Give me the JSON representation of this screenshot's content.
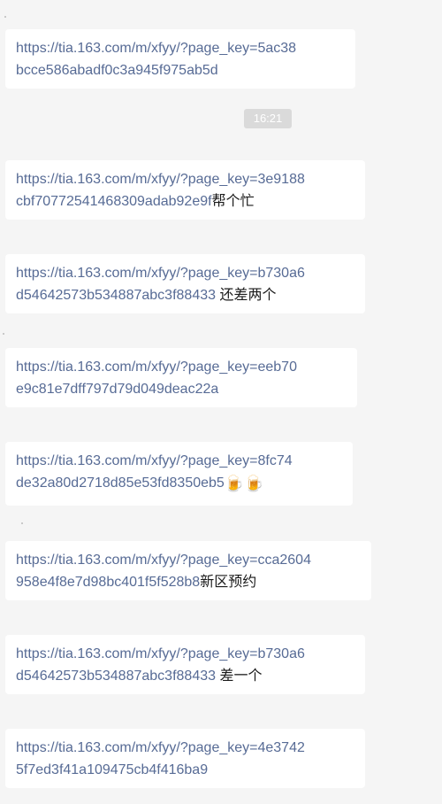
{
  "timestamp": "16:21",
  "messages": [
    {
      "link_line1": "https://tia.163.com/m/xfyy/?page_key=5ac38",
      "link_line2": "bcce586abadf0c3a945f975ab5d",
      "suffix": ""
    },
    {
      "link_line1": "https://tia.163.com/m/xfyy/?page_key=3e9188",
      "link_line2": "cbf70772541468309adab92e9f",
      "suffix": "帮个忙"
    },
    {
      "link_line1": "https://tia.163.com/m/xfyy/?page_key=b730a6",
      "link_line2": "d54642573b534887abc3f88433",
      "suffix": " 还差两个"
    },
    {
      "link_line1": "https://tia.163.com/m/xfyy/?page_key=eeb70",
      "link_line2": "e9c81e7dff797d79d049deac22a",
      "suffix": ""
    },
    {
      "link_line1": "https://tia.163.com/m/xfyy/?page_key=8fc74",
      "link_line2": "de32a80d2718d85e53fd8350eb5",
      "suffix": "🍺🍺"
    },
    {
      "link_line1": "https://tia.163.com/m/xfyy/?page_key=cca2604",
      "link_line2": "958e4f8e7d98bc401f5f528b8",
      "suffix": "新区预约"
    },
    {
      "link_line1": "https://tia.163.com/m/xfyy/?page_key=b730a6",
      "link_line2": "d54642573b534887abc3f88433",
      "suffix": " 差一个"
    },
    {
      "link_line1": "https://tia.163.com/m/xfyy/?page_key=4e3742",
      "link_line2": "5f7ed3f41a109475cb4f416ba9",
      "suffix": ""
    }
  ]
}
